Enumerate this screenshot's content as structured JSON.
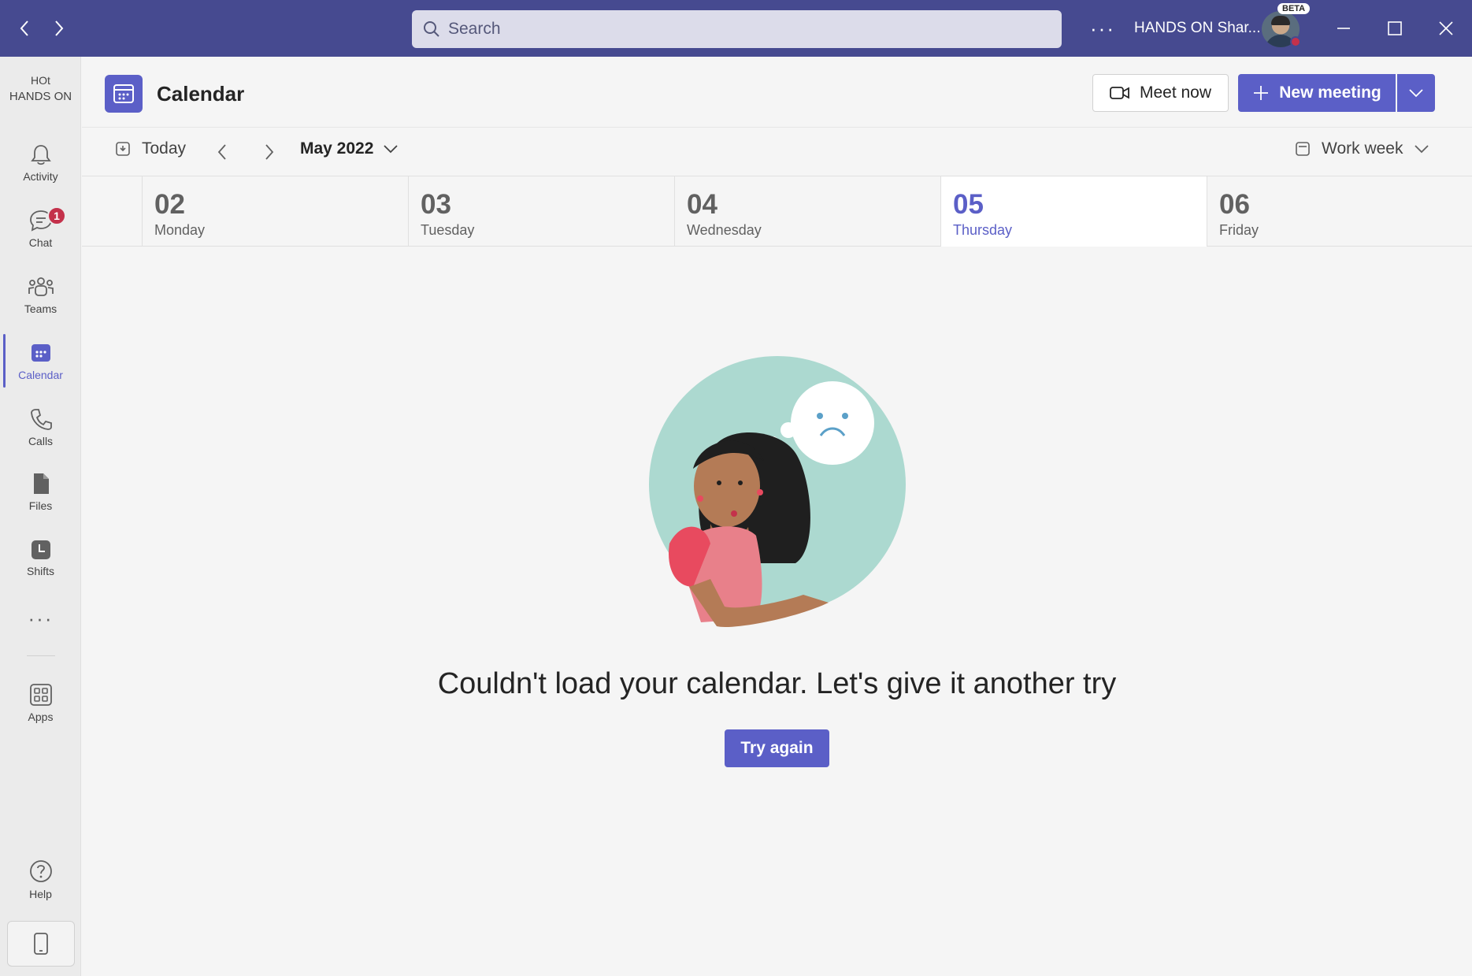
{
  "titlebar": {
    "search_placeholder": "Search",
    "more_label": "···",
    "org_name": "HANDS ON Shar...",
    "beta_badge": "BETA"
  },
  "rail": {
    "org_short": "HOt",
    "org_name": "HANDS ON",
    "items": [
      {
        "label": "Activity"
      },
      {
        "label": "Chat",
        "badge": "1"
      },
      {
        "label": "Teams"
      },
      {
        "label": "Calendar",
        "active": true
      },
      {
        "label": "Calls"
      },
      {
        "label": "Files"
      },
      {
        "label": "Shifts"
      },
      {
        "label": "Apps"
      },
      {
        "label": "Help"
      }
    ],
    "more_label": "···"
  },
  "header": {
    "title": "Calendar",
    "meet_now": "Meet now",
    "new_meeting": "New meeting"
  },
  "toolbar": {
    "today": "Today",
    "month": "May 2022",
    "view": "Work week"
  },
  "days": [
    {
      "num": "02",
      "name": "Monday"
    },
    {
      "num": "03",
      "name": "Tuesday"
    },
    {
      "num": "04",
      "name": "Wednesday"
    },
    {
      "num": "05",
      "name": "Thursday",
      "today": true
    },
    {
      "num": "06",
      "name": "Friday"
    }
  ],
  "error": {
    "message": "Couldn't load your calendar. Let's give it another try",
    "retry": "Try again"
  },
  "colors": {
    "titlebar": "#464a90",
    "accent": "#5b5fc7",
    "badge": "#c4314b"
  }
}
